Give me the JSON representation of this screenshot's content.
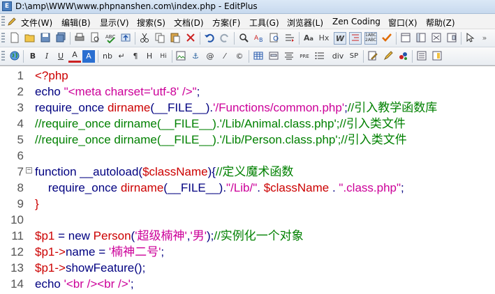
{
  "window": {
    "title": "D:\\amp\\WWW\\www.phpnanshen.com\\index.php - EditPlus"
  },
  "menu": [
    "文件(W)",
    "编辑(B)",
    "显示(V)",
    "搜索(S)",
    "文档(D)",
    "方案(F)",
    "工具(G)",
    "浏览器(L)",
    "Zen Coding",
    "窗口(X)",
    "帮助(Z)"
  ],
  "toolbar1": [
    "new-file",
    "open-file",
    "save",
    "save-all",
    "print",
    "print-preview",
    "spellcheck",
    "ftp-upload",
    "cut",
    "copy",
    "paste",
    "delete",
    "undo",
    "redo",
    "find",
    "replace",
    "find-in-files",
    "goto",
    "font",
    "hex",
    "word-wrap",
    "outline",
    "column-select",
    "checkmark",
    "document-selector",
    "cliptext",
    "output-window",
    "directory-window",
    "cursor-tool"
  ],
  "toolbar2": [
    {
      "icon": "globe",
      "label": ""
    },
    {
      "icon": "bold",
      "label": "B"
    },
    {
      "icon": "italic",
      "label": "I"
    },
    {
      "icon": "underline",
      "label": "U"
    },
    {
      "icon": "font-color",
      "label": "A"
    },
    {
      "icon": "highlight",
      "label": "A"
    },
    {
      "icon": "nbsp",
      "label": "nb"
    },
    {
      "icon": "br",
      "label": "↵"
    },
    {
      "icon": "paragraph",
      "label": "¶"
    },
    {
      "icon": "hr",
      "label": "H"
    },
    {
      "icon": "heading",
      "label": "Hi"
    },
    {
      "icon": "image",
      "label": ""
    },
    {
      "icon": "anchor",
      "label": "⚓"
    },
    {
      "icon": "email",
      "label": "@"
    },
    {
      "icon": "comment",
      "label": "⁄"
    },
    {
      "icon": "copyright",
      "label": "©"
    },
    {
      "icon": "table",
      "label": ""
    },
    {
      "icon": "form",
      "label": ""
    },
    {
      "icon": "center",
      "label": ""
    },
    {
      "icon": "pre",
      "label": "PRE"
    },
    {
      "icon": "list",
      "label": ""
    },
    {
      "icon": "div",
      "label": "div"
    },
    {
      "icon": "span",
      "label": "SP"
    },
    {
      "icon": "edit-tool",
      "label": ""
    },
    {
      "icon": "pen-tool",
      "label": ""
    },
    {
      "icon": "color-picker",
      "label": ""
    },
    {
      "icon": "doc-list",
      "label": ""
    },
    {
      "icon": "panel",
      "label": ""
    }
  ],
  "code": {
    "line_numbers": [
      "1",
      "2",
      "3",
      "4",
      "5",
      "6",
      "7",
      "8",
      "9",
      "10",
      "11",
      "12",
      "13",
      "14"
    ],
    "lines": [
      [
        {
          "t": "<?php",
          "c": "php"
        }
      ],
      [
        {
          "t": "echo ",
          "c": "kw"
        },
        {
          "t": "\"<meta charset='utf-8' />\"",
          "c": "str"
        },
        {
          "t": ";",
          "c": "kw"
        }
      ],
      [
        {
          "t": "require_once ",
          "c": "kw"
        },
        {
          "t": "dirname",
          "c": "fn"
        },
        {
          "t": "(__FILE__).",
          "c": "kw"
        },
        {
          "t": "'/Functions/common.php'",
          "c": "str"
        },
        {
          "t": ";",
          "c": "kw"
        },
        {
          "t": "//引入教学函数库",
          "c": "cmt"
        }
      ],
      [
        {
          "t": "//require_once dirname(__FILE__).'/Lib/Animal.class.php';//引入类文件",
          "c": "cmt"
        }
      ],
      [
        {
          "t": "//require_once dirname(__FILE__).'/Lib/Person.class.php';//引入类文件",
          "c": "cmt"
        }
      ],
      [],
      [
        {
          "t": "function ",
          "c": "kw"
        },
        {
          "t": "__autoload(",
          "c": "kw"
        },
        {
          "t": "$className",
          "c": "var"
        },
        {
          "t": "){",
          "c": "kw"
        },
        {
          "t": "//定义魔术函数",
          "c": "cmt"
        }
      ],
      [
        {
          "t": "    require_once ",
          "c": "kw"
        },
        {
          "t": "dirname",
          "c": "fn"
        },
        {
          "t": "(__FILE__).",
          "c": "kw"
        },
        {
          "t": "\"/Lib/\"",
          "c": "str"
        },
        {
          "t": ". ",
          "c": "kw"
        },
        {
          "t": "$className",
          "c": "var"
        },
        {
          "t": " . ",
          "c": "kw"
        },
        {
          "t": "\".class.php\"",
          "c": "str"
        },
        {
          "t": ";",
          "c": "kw"
        }
      ],
      [
        {
          "t": "}",
          "c": "var"
        }
      ],
      [],
      [
        {
          "t": "$p1",
          "c": "var"
        },
        {
          "t": " = new ",
          "c": "kw"
        },
        {
          "t": "Person",
          "c": "fn"
        },
        {
          "t": "(",
          "c": "kw"
        },
        {
          "t": "'超级楠神'",
          "c": "str"
        },
        {
          "t": ",",
          "c": "kw"
        },
        {
          "t": "'男'",
          "c": "str"
        },
        {
          "t": ");",
          "c": "kw"
        },
        {
          "t": "//实例化一个对象",
          "c": "cmt"
        }
      ],
      [
        {
          "t": "$p1",
          "c": "var"
        },
        {
          "t": "->",
          "c": "var"
        },
        {
          "t": "name = ",
          "c": "kw"
        },
        {
          "t": "'楠神二号'",
          "c": "str"
        },
        {
          "t": ";",
          "c": "kw"
        }
      ],
      [
        {
          "t": "$p1",
          "c": "var"
        },
        {
          "t": "->",
          "c": "var"
        },
        {
          "t": "showFeature();",
          "c": "kw"
        }
      ],
      [
        {
          "t": "echo ",
          "c": "kw"
        },
        {
          "t": "'<br /><br />'",
          "c": "str"
        },
        {
          "t": ";",
          "c": "kw"
        }
      ]
    ]
  }
}
